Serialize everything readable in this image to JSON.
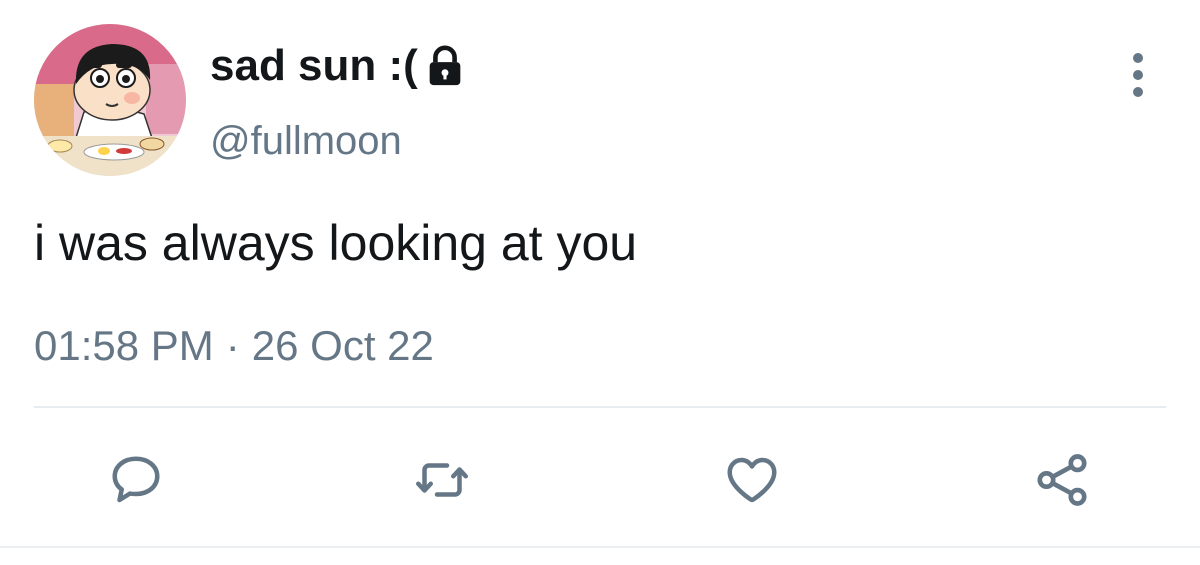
{
  "tweet": {
    "display_name": "sad sun :(",
    "handle": "@fullmoon",
    "text": "i was always looking at you",
    "time": "01:58 PM",
    "separator": "·",
    "date": "26 Oct 22",
    "protected_icon": "lock-icon",
    "more_icon": "vertical-ellipsis-icon"
  },
  "actions": [
    {
      "name": "reply",
      "icon": "speech-bubble-icon"
    },
    {
      "name": "retweet",
      "icon": "retweet-arrows-icon"
    },
    {
      "name": "like",
      "icon": "heart-icon"
    },
    {
      "name": "share",
      "icon": "share-nodes-icon"
    }
  ],
  "colors": {
    "text_primary": "#14171a",
    "text_secondary": "#657786",
    "icon": "#657786",
    "divider": "#e6ecf0"
  }
}
